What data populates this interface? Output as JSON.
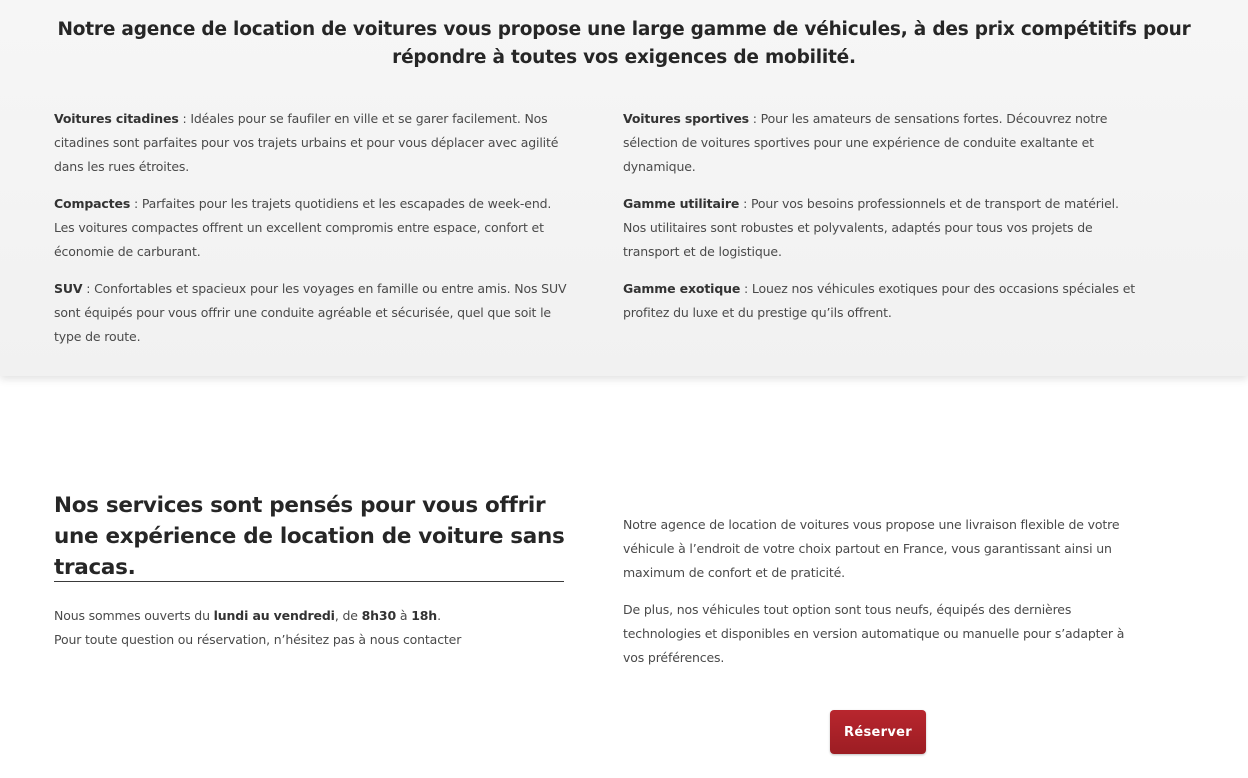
{
  "vehicles": {
    "title": "Notre agence de location de voitures vous propose une large gamme de véhicules, à des prix compétitifs pour répondre à toutes vos exigences de mobilité.",
    "left_items": [
      {
        "name": "Voitures citadines",
        "text": " : Idéales pour se faufiler en ville et se garer facilement. Nos citadines sont parfaites pour vos trajets urbains et pour vous déplacer avec agilité dans les rues étroites."
      },
      {
        "name": "Compactes",
        "text": " : Parfaites pour les trajets quotidiens et les escapades de week-end. Les voitures compactes offrent un excellent compromis entre espace, confort et économie de carburant."
      },
      {
        "name": "SUV",
        "text": " : Confortables et spacieux pour les voyages en famille ou entre amis. Nos SUV sont équipés pour vous offrir une conduite agréable et sécurisée, quel que soit le type de route."
      }
    ],
    "right_items": [
      {
        "name": "Voitures sportives",
        "text": " : Pour les amateurs de sensations fortes. Découvrez notre sélection de voitures sportives pour une expérience de conduite exaltante et dynamique."
      },
      {
        "name": "Gamme utilitaire",
        "text": " : Pour vos besoins professionnels et de transport de matériel. Nos utilitaires sont robustes et polyvalents, adaptés pour tous vos projets de transport et de logistique."
      },
      {
        "name": "Gamme exotique",
        "text": " : Louez nos véhicules exotiques pour des occasions spéciales et profitez du luxe et du prestige qu’ils offrent."
      }
    ]
  },
  "services": {
    "title": "Nos services sont pensés pour vous offrir une expérience de location de voiture sans tracas.",
    "hours": {
      "prefix": "Nous sommes ouverts du ",
      "days": "lundi au vendredi",
      "mid1": ", de ",
      "open": "8h30",
      "mid2": " à ",
      "close": "18h",
      "end": ".",
      "contact": "Pour toute question ou réservation, n’hésitez pas à nous contacter"
    },
    "paragraphs": [
      "Notre agence de location de voitures vous propose une livraison flexible de votre véhicule à l’endroit de votre choix partout en France, vous garantissant ainsi un maximum de confort et de praticité.",
      "De plus, nos véhicules tout option sont tous neufs, équipés des dernières technologies et disponibles en version automatique ou manuelle pour s’adapter à vos préférences."
    ],
    "reserve_label": "Réserver"
  },
  "colors": {
    "accent": "#b8262e",
    "panel_bg": "#f3f3f3",
    "text": "#4a4a4a"
  }
}
